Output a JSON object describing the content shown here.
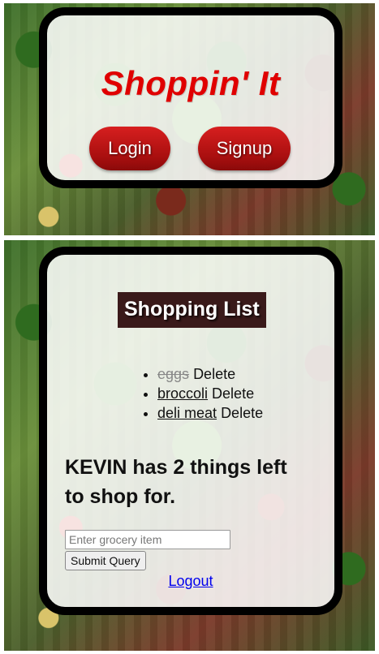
{
  "landing": {
    "brand_title": "Shoppin' It",
    "login_label": "Login",
    "signup_label": "Signup"
  },
  "list": {
    "title": "Shopping List",
    "items": [
      {
        "name": "eggs",
        "completed": true,
        "delete_label": "Delete"
      },
      {
        "name": "broccoli",
        "completed": false,
        "delete_label": "Delete"
      },
      {
        "name": "deli meat",
        "completed": false,
        "delete_label": "Delete"
      }
    ],
    "summary": "KEVIN has 2 things left to shop for.",
    "input_placeholder": "Enter grocery item",
    "submit_label": "Submit Query",
    "logout_label": "Logout"
  },
  "colors": {
    "brand_red": "#e00000",
    "button_red": "#b81414",
    "title_bg": "#3a1a1a",
    "link_blue": "#0000ee"
  }
}
